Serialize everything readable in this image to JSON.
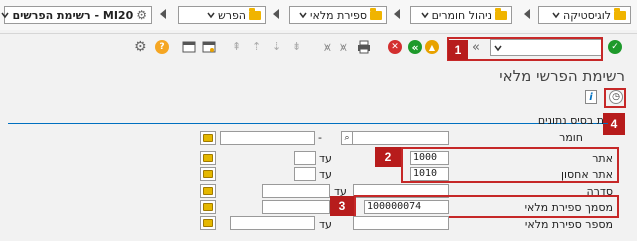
{
  "breadcrumb": {
    "items": [
      {
        "label": "לוגיסטיקה"
      },
      {
        "label": "ניהול חומרים"
      },
      {
        "label": "ספירת מלאי"
      },
      {
        "label": "הפרש"
      },
      {
        "label": "MI20 - רשימת הפרשים"
      }
    ]
  },
  "page": {
    "title": "רשימת הפרשי מלאי"
  },
  "section": {
    "title": "ת בסיס נתונים"
  },
  "form": {
    "to_label": "עד",
    "rows": [
      {
        "label": "חומר",
        "from": "",
        "to": ""
      },
      {
        "label": "אתר",
        "from": "1000",
        "to": ""
      },
      {
        "label": "אתר אחסון",
        "from": "1010",
        "to": ""
      },
      {
        "label": "סדרה",
        "from": "",
        "to": ""
      },
      {
        "label": "מסמך ספירת מלאי",
        "from": "100000074",
        "to": ""
      },
      {
        "label": "מספר ספירת מלאי",
        "from": "",
        "to": ""
      }
    ]
  },
  "callouts": [
    "1",
    "2",
    "3",
    "4"
  ],
  "colors": {
    "accent": "#0070c0",
    "callout": "#c62828",
    "folder": "#f0b400"
  }
}
